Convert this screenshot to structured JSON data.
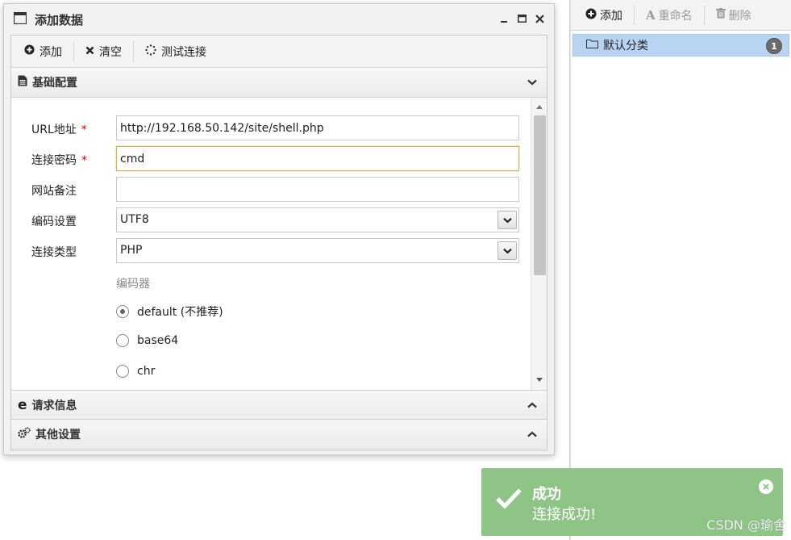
{
  "dialog": {
    "title": "添加数据",
    "toolbar": {
      "add_label": "添加",
      "clear_label": "清空",
      "test_label": "测试连接"
    },
    "sections": {
      "basic": "基础配置",
      "request": "请求信息",
      "other": "其他设置"
    },
    "form": {
      "url_label": "URL地址",
      "url_value": "http://192.168.50.142/site/shell.php",
      "password_label": "连接密码",
      "password_value": "cmd",
      "note_label": "网站备注",
      "note_value": "",
      "encoding_label": "编码设置",
      "encoding_value": "UTF8",
      "type_label": "连接类型",
      "type_value": "PHP",
      "required_mark": "*",
      "encoder_label": "编码器",
      "encoders": [
        {
          "label": "default (不推荐)",
          "checked": true
        },
        {
          "label": "base64",
          "checked": false
        },
        {
          "label": "chr",
          "checked": false
        }
      ]
    }
  },
  "right_panel": {
    "toolbar": {
      "add_label": "添加",
      "rename_label": "重命名",
      "delete_label": "删除"
    },
    "category": {
      "label": "默认分类",
      "count": "1"
    }
  },
  "toast": {
    "title": "成功",
    "message": "连接成功!",
    "color": "#8fc487"
  },
  "watermark": "CSDN @瑜舍"
}
